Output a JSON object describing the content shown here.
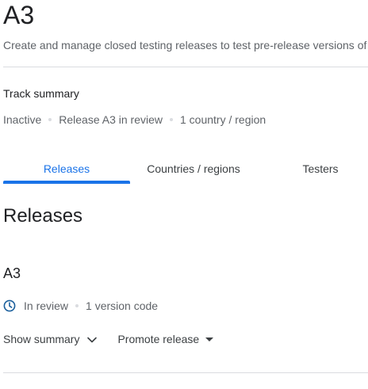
{
  "header": {
    "title": "A3",
    "subtitle": "Create and manage closed testing releases to test pre-release versions of your app"
  },
  "track_summary": {
    "label": "Track summary",
    "status": "Inactive",
    "release": "Release A3 in review",
    "countries": "1 country / region"
  },
  "tabs": [
    {
      "label": "Releases",
      "active": true
    },
    {
      "label": "Countries / regions",
      "active": false
    },
    {
      "label": "Testers",
      "active": false
    }
  ],
  "releases": {
    "heading": "Releases",
    "items": [
      {
        "name": "A3",
        "status": "In review",
        "version_codes": "1 version code",
        "status_icon": "clock-icon"
      }
    ]
  },
  "actions": {
    "show_summary": "Show summary",
    "promote_release": "Promote release"
  },
  "colors": {
    "accent": "#1a73e8",
    "status_icon": "#1a5f9c",
    "muted_text": "#5f6368",
    "divider": "#dadce0"
  }
}
